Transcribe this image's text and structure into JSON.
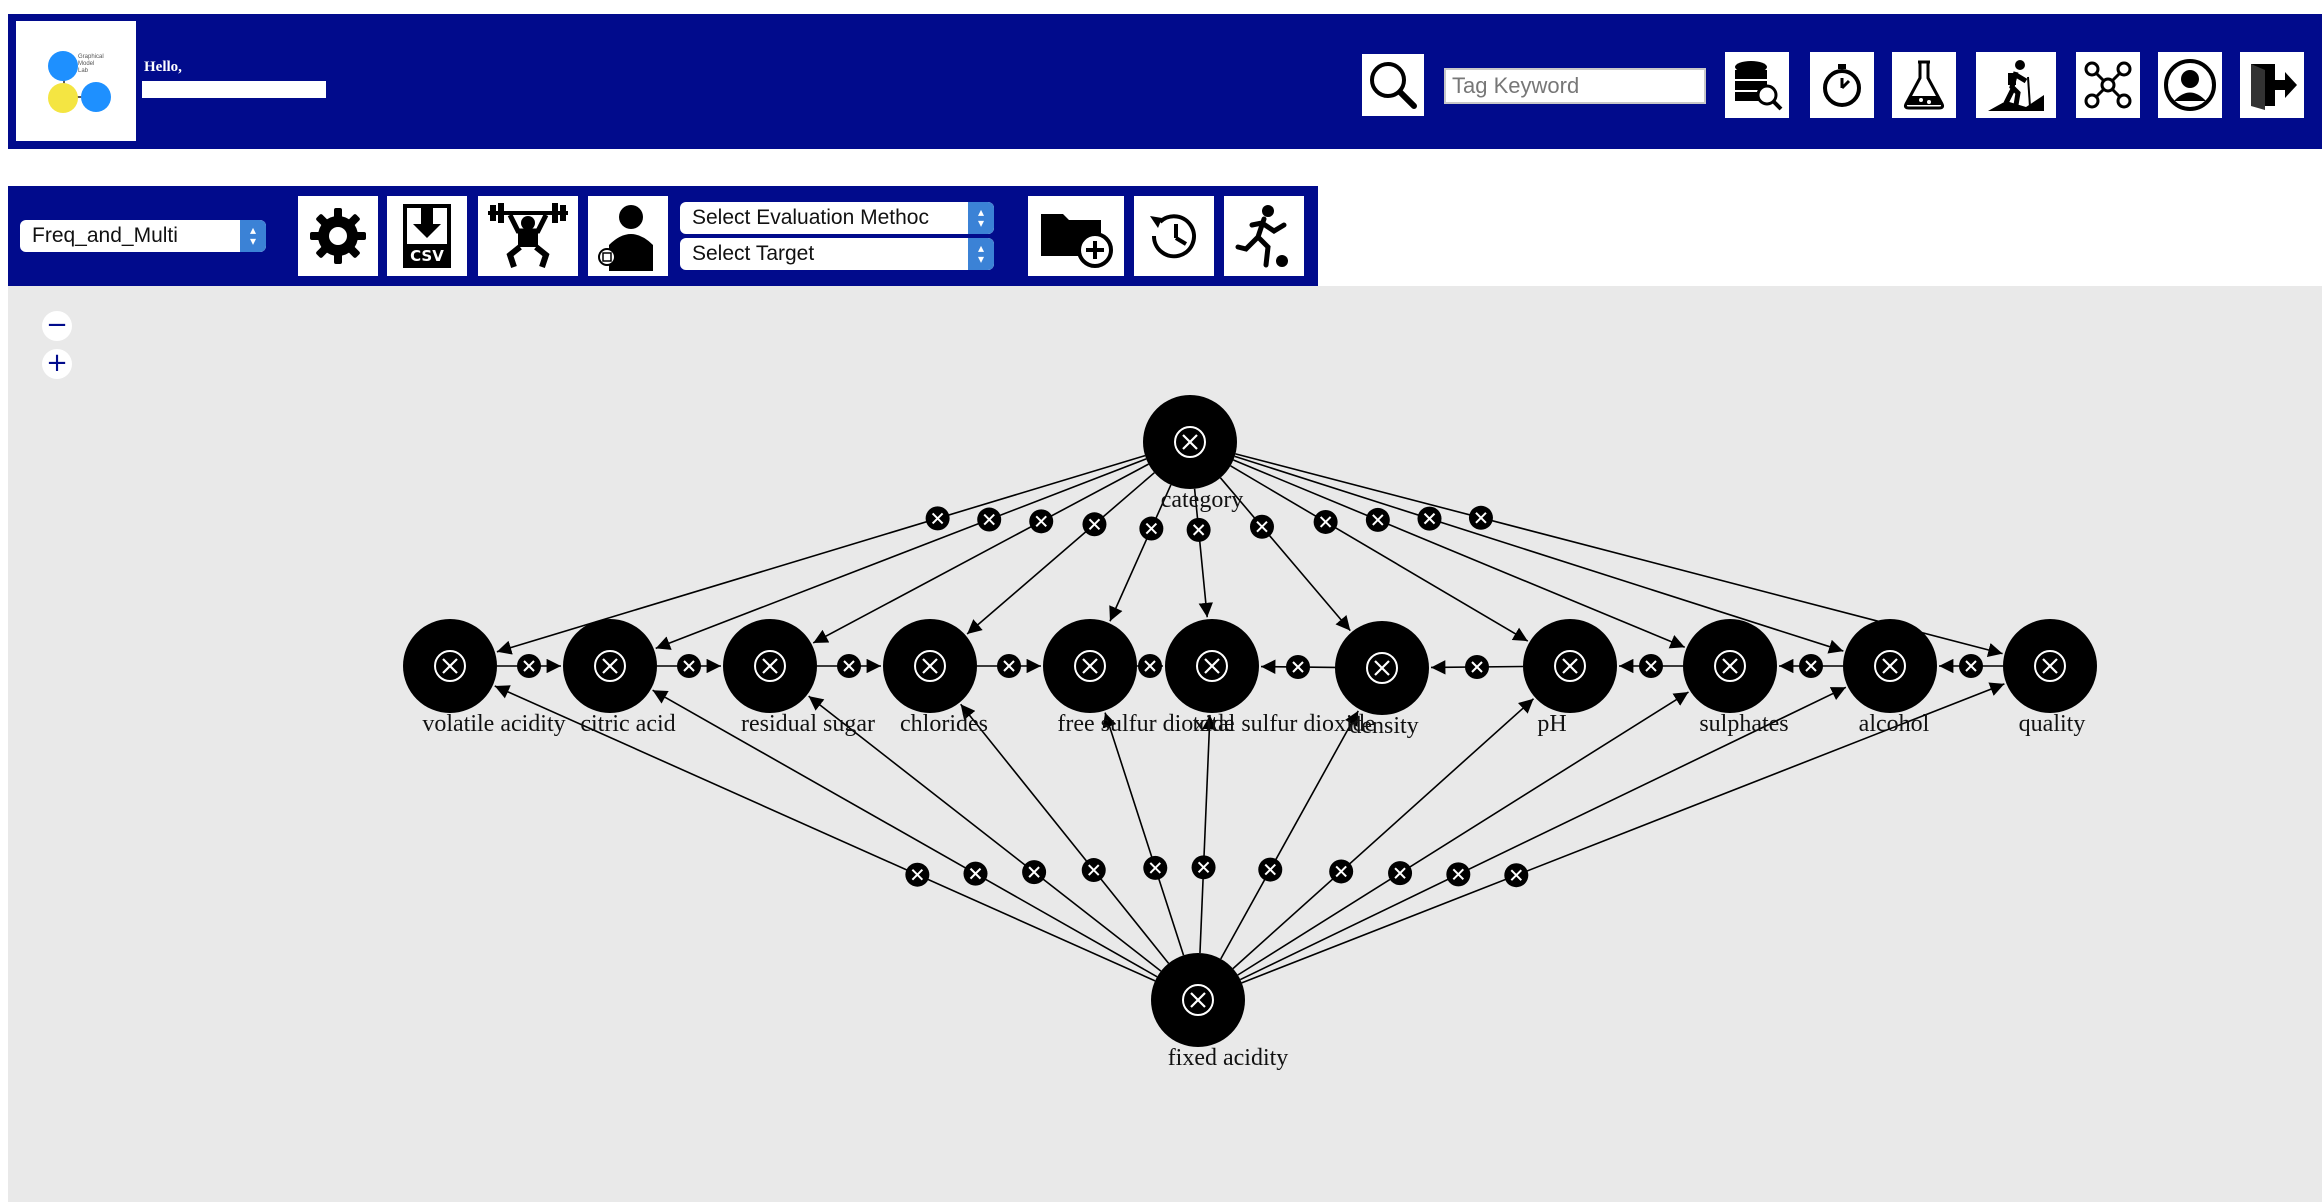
{
  "header": {
    "logo_lines": [
      "Graphical",
      "Model",
      "Lab"
    ],
    "greeting": "Hello,",
    "search_placeholder": "Tag Keyword",
    "icons": [
      "search-icon",
      "database-search-icon",
      "timer-icon",
      "flask-icon",
      "hiking-icon",
      "network-icon",
      "user-profile-icon",
      "logout-icon"
    ]
  },
  "toolbar": {
    "model_select": "Freq_and_Multi",
    "evaluation_select": "Select Evaluation Methoc",
    "target_select": "Select Target",
    "icons": [
      "settings-icon",
      "csv-download-icon",
      "weightlifter-icon",
      "user-data-icon",
      "folder-add-icon",
      "history-icon",
      "soccer-player-icon"
    ]
  },
  "zoom": {
    "minus": "−",
    "plus": "+"
  },
  "graph": {
    "nodes": [
      {
        "id": "category",
        "label": "category"
      },
      {
        "id": "volatile acidity",
        "label": "volatile acidity"
      },
      {
        "id": "citric acid",
        "label": "citric acid"
      },
      {
        "id": "residual sugar",
        "label": "residual sugar"
      },
      {
        "id": "chlorides",
        "label": "chlorides"
      },
      {
        "id": "free sulfur dioxide",
        "label": "free sulfur dioxide"
      },
      {
        "id": "total sulfur dioxide",
        "label": "total sulfur dioxide"
      },
      {
        "id": "density",
        "label": "density"
      },
      {
        "id": "pH",
        "label": "pH"
      },
      {
        "id": "sulphates",
        "label": "sulphates"
      },
      {
        "id": "alcohol",
        "label": "alcohol"
      },
      {
        "id": "quality",
        "label": "quality"
      },
      {
        "id": "fixed acidity",
        "label": "fixed acidity"
      }
    ],
    "edges": [
      {
        "from": "category",
        "to": "volatile acidity"
      },
      {
        "from": "category",
        "to": "citric acid"
      },
      {
        "from": "category",
        "to": "residual sugar"
      },
      {
        "from": "category",
        "to": "chlorides"
      },
      {
        "from": "category",
        "to": "free sulfur dioxide"
      },
      {
        "from": "category",
        "to": "total sulfur dioxide"
      },
      {
        "from": "category",
        "to": "density"
      },
      {
        "from": "category",
        "to": "pH"
      },
      {
        "from": "category",
        "to": "sulphates"
      },
      {
        "from": "category",
        "to": "alcohol"
      },
      {
        "from": "category",
        "to": "quality"
      },
      {
        "from": "fixed acidity",
        "to": "volatile acidity"
      },
      {
        "from": "fixed acidity",
        "to": "citric acid"
      },
      {
        "from": "fixed acidity",
        "to": "residual sugar"
      },
      {
        "from": "fixed acidity",
        "to": "chlorides"
      },
      {
        "from": "fixed acidity",
        "to": "free sulfur dioxide"
      },
      {
        "from": "fixed acidity",
        "to": "total sulfur dioxide"
      },
      {
        "from": "fixed acidity",
        "to": "density"
      },
      {
        "from": "fixed acidity",
        "to": "pH"
      },
      {
        "from": "fixed acidity",
        "to": "sulphates"
      },
      {
        "from": "fixed acidity",
        "to": "alcohol"
      },
      {
        "from": "fixed acidity",
        "to": "quality"
      },
      {
        "from": "volatile acidity",
        "to": "citric acid"
      },
      {
        "from": "citric acid",
        "to": "residual sugar"
      },
      {
        "from": "residual sugar",
        "to": "chlorides"
      },
      {
        "from": "chlorides",
        "to": "free sulfur dioxide"
      },
      {
        "from": "free sulfur dioxide",
        "to": "total sulfur dioxide"
      },
      {
        "from": "density",
        "to": "total sulfur dioxide"
      },
      {
        "from": "pH",
        "to": "density"
      },
      {
        "from": "sulphates",
        "to": "pH"
      },
      {
        "from": "alcohol",
        "to": "sulphates"
      },
      {
        "from": "quality",
        "to": "alcohol"
      }
    ]
  },
  "colors": {
    "header_bg": "#010b8c",
    "canvas_bg": "#e9e9e9",
    "node": "#000000",
    "select_arrow": "#3b82d6"
  }
}
